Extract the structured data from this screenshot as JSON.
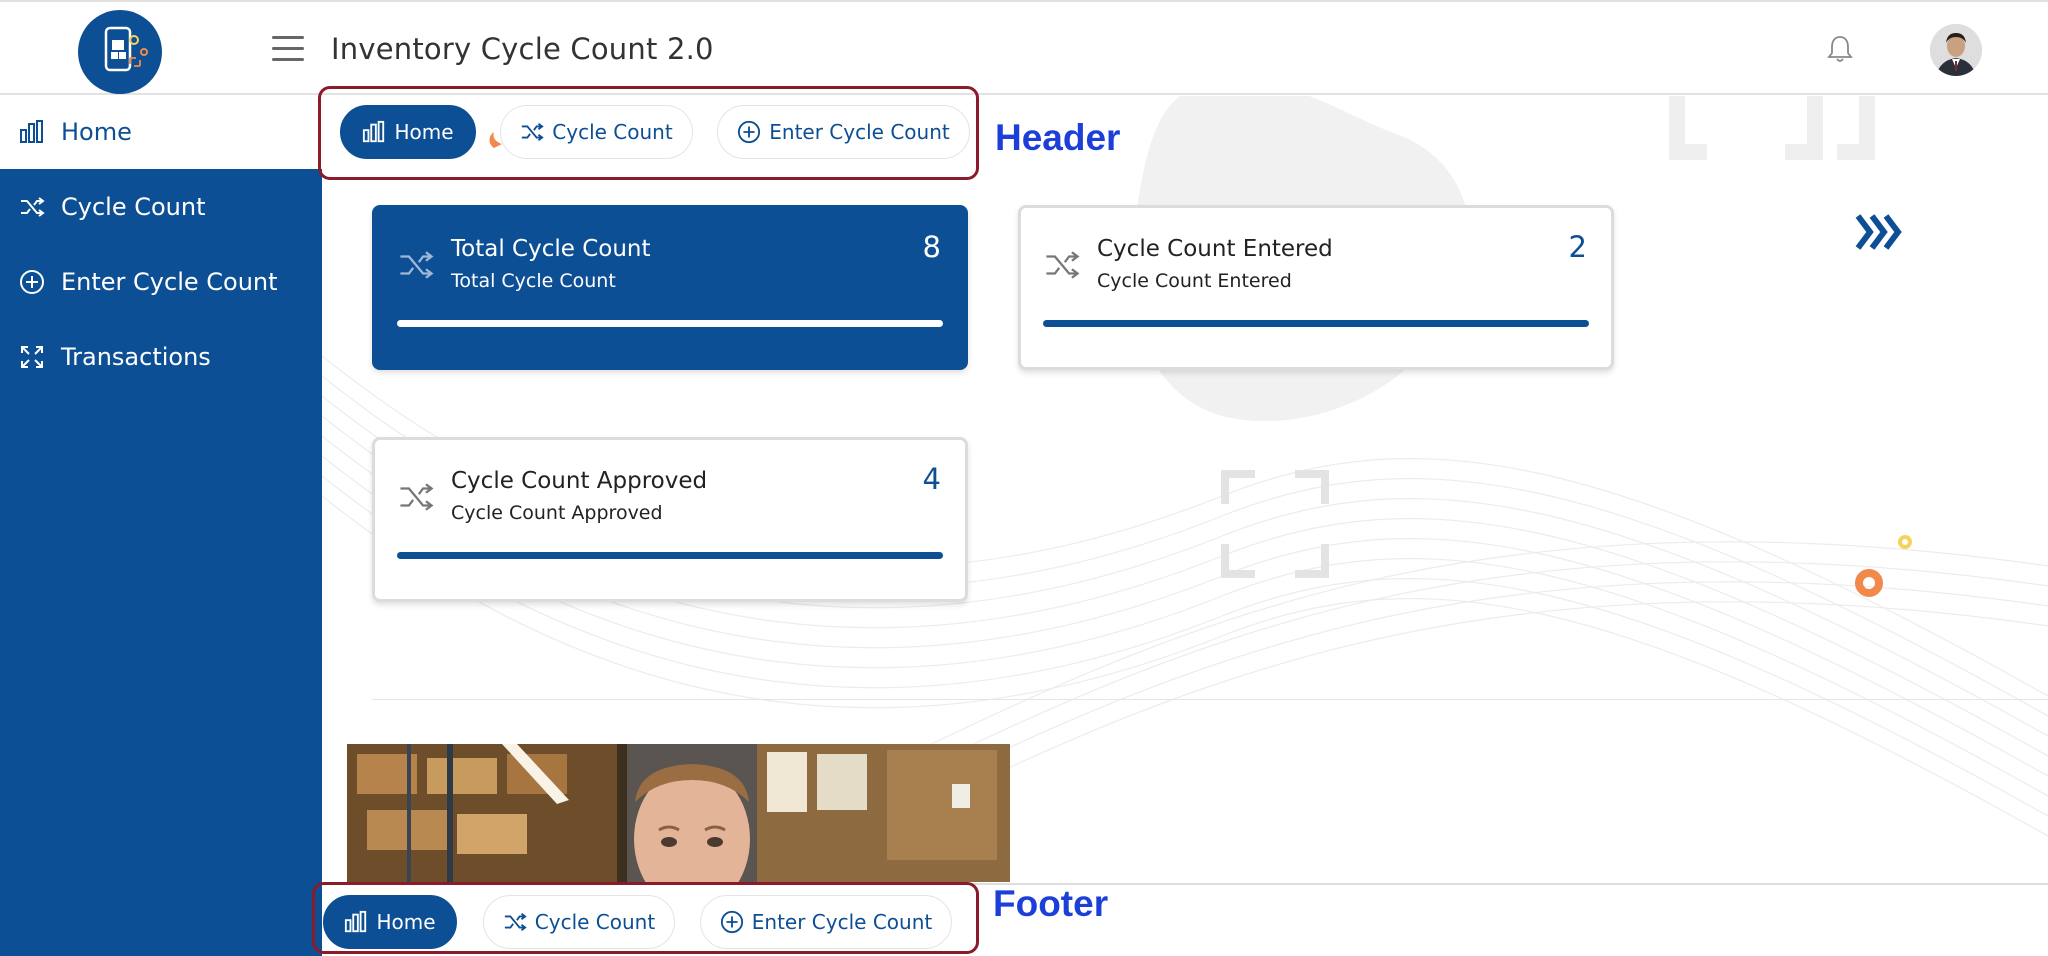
{
  "app": {
    "title": "Inventory Cycle Count 2.0"
  },
  "sidebar": {
    "items": [
      {
        "label": "Home",
        "icon": "bar-chart-icon",
        "active": true
      },
      {
        "label": "Cycle Count",
        "icon": "shuffle-icon",
        "active": false
      },
      {
        "label": "Enter Cycle Count",
        "icon": "plus-circle-icon",
        "active": false
      },
      {
        "label": "Transactions",
        "icon": "expand-icon",
        "active": false
      }
    ]
  },
  "header_nav": {
    "annotation": "Header",
    "items": [
      {
        "label": "Home",
        "icon": "bar-chart-icon",
        "active": true
      },
      {
        "label": "Cycle Count",
        "icon": "shuffle-icon",
        "active": false
      },
      {
        "label": "Enter Cycle Count",
        "icon": "plus-circle-icon",
        "active": false
      }
    ]
  },
  "footer_nav": {
    "annotation": "Footer",
    "items": [
      {
        "label": "Home",
        "icon": "bar-chart-icon",
        "active": true
      },
      {
        "label": "Cycle Count",
        "icon": "shuffle-icon",
        "active": false
      },
      {
        "label": "Enter Cycle Count",
        "icon": "plus-circle-icon",
        "active": false
      }
    ]
  },
  "cards": [
    {
      "title": "Total Cycle Count",
      "subtitle": "Total Cycle Count",
      "count": "8",
      "icon": "shuffle-icon",
      "highlight": true
    },
    {
      "title": "Cycle Count Entered",
      "subtitle": "Cycle Count Entered",
      "count": "2",
      "icon": "shuffle-icon",
      "highlight": false
    },
    {
      "title": "Cycle Count Approved",
      "subtitle": "Cycle Count Approved",
      "count": "4",
      "icon": "shuffle-icon",
      "highlight": false
    }
  ],
  "colors": {
    "brand": "#0d4f94",
    "frame": "#8b1a2b",
    "annotation": "#1c3fd8",
    "accent_orange": "#f0894a",
    "accent_yellow": "#f4d35e"
  }
}
